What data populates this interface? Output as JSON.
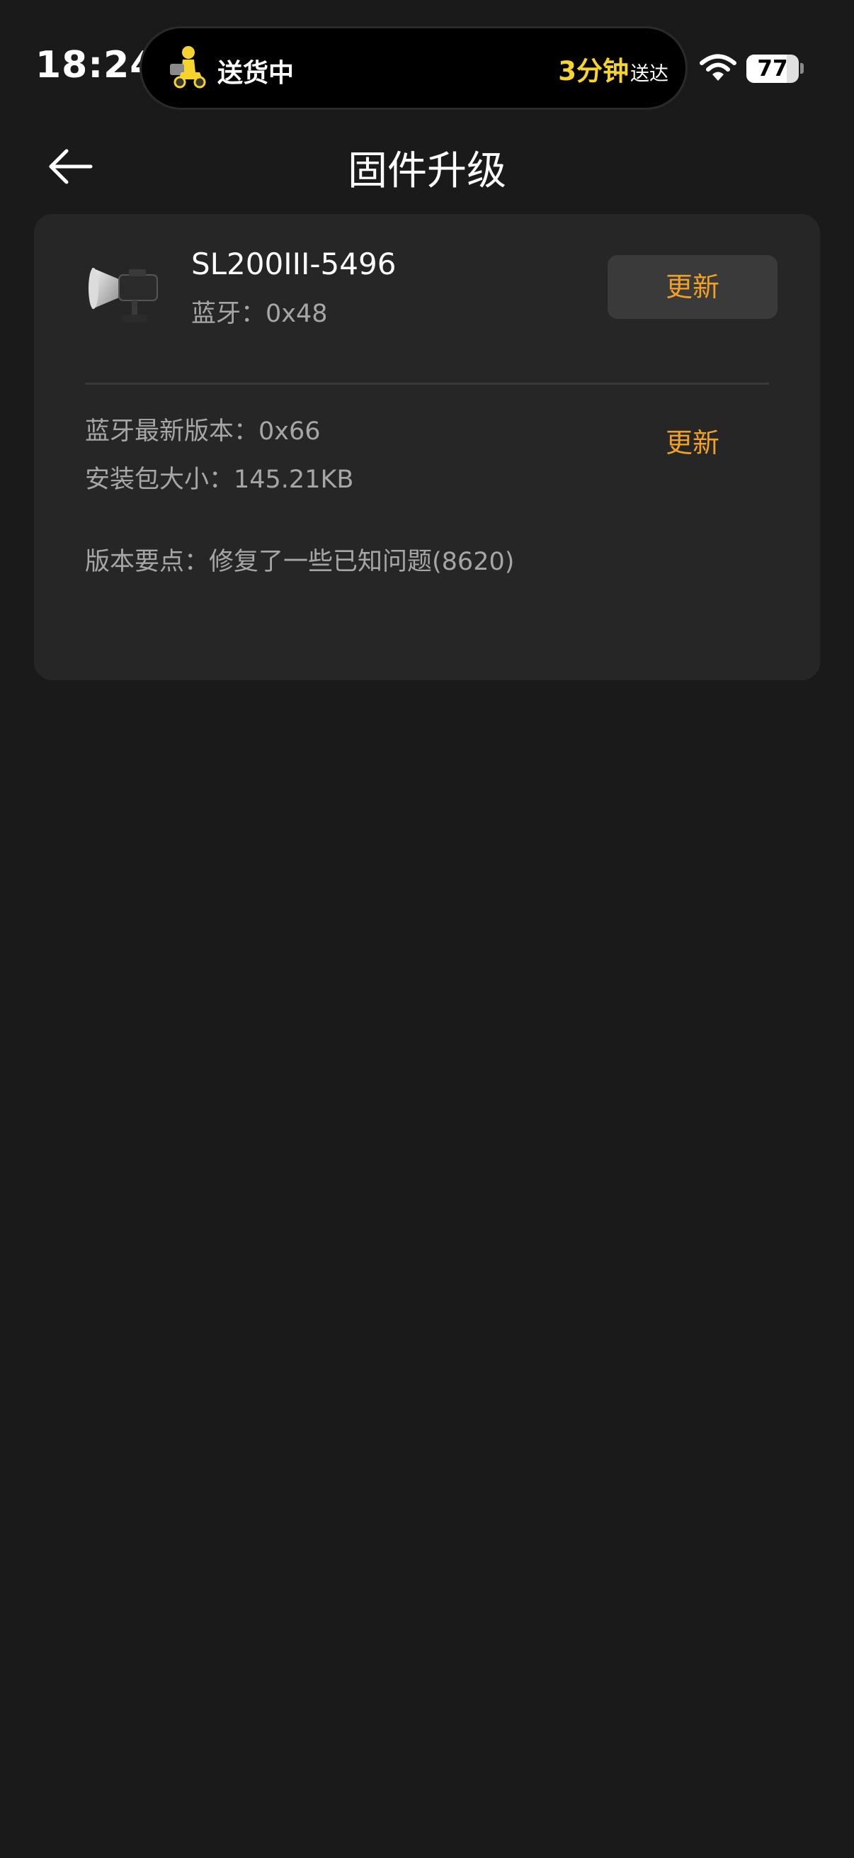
{
  "status_bar": {
    "time": "18:24",
    "island": {
      "status": "送货中",
      "eta_minutes": "3分钟",
      "eta_suffix": "送达",
      "icon": "delivery-courier-icon"
    },
    "wifi_icon": "wifi-icon",
    "battery_level": "77",
    "battery_fraction": 0.77
  },
  "header": {
    "back_icon": "back-arrow-icon",
    "title": "固件升级"
  },
  "device": {
    "image_icon": "studio-light-icon",
    "name": "SL200III-5496",
    "bluetooth_version": "蓝牙：0x48",
    "update_button_label": "更新"
  },
  "firmware": {
    "latest_version": "蓝牙最新版本：0x66",
    "package_size": "安装包大小：145.21KB",
    "update_link_label": "更新",
    "release_notes": "版本要点：修复了一些已知问题(8620)"
  },
  "colors": {
    "background": "#1a1a1a",
    "card": "#262626",
    "accent": "#f0a028",
    "island_highlight": "#f6d32d",
    "secondary_text": "#a6a6a6"
  }
}
